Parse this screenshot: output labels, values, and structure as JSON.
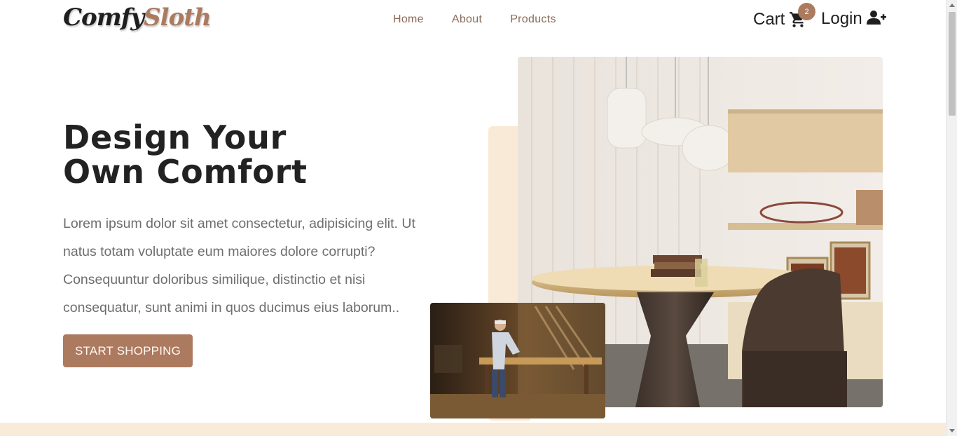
{
  "brand": {
    "logo_part1": "Comfy",
    "logo_part2": "Sloth",
    "accent": "#ab7a5f"
  },
  "nav": {
    "links": [
      {
        "label": "Home"
      },
      {
        "label": "About"
      },
      {
        "label": "Products"
      }
    ]
  },
  "cart": {
    "label": "Cart",
    "icon": "shopping-cart-icon",
    "count": "2"
  },
  "login": {
    "label": "Login",
    "icon": "user-plus-icon"
  },
  "hero": {
    "title_line1": "Design Your",
    "title_line2": "Own Comfort",
    "description": "Lorem ipsum dolor sit amet consectetur, adipisicing elit. Ut natus totam voluptate eum maiores dolore corrupti? Consequuntur doloribus similique, distinctio et nisi consequatur, sunt animi in quos ducimus eius laborum..",
    "button_label": "START SHOPPING"
  },
  "colors": {
    "text": "#222222",
    "muted": "#6e6e6e",
    "accent_light": "#f9e9d7"
  }
}
